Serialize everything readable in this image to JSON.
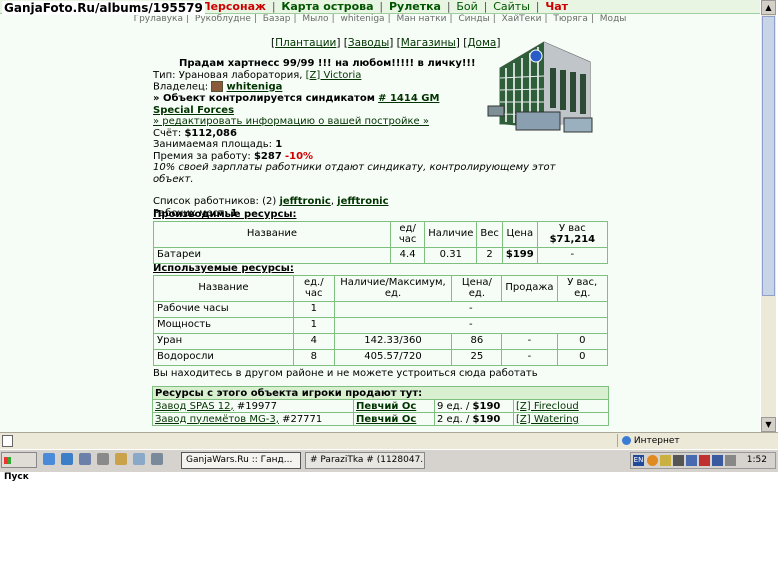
{
  "watermark": "GanjaFoto.Ru/albums/195579",
  "top_nav": {
    "character": "Персонаж",
    "island_map": "Карта острова",
    "roulette": "Рулетка",
    "fight": "Бой",
    "sites": "Сайты",
    "chat": "Чат"
  },
  "sub_nav": [
    "Грулавука",
    "Рукоблудне",
    "Базар",
    "Мыло",
    "whiteniga",
    "Ман натки",
    "Синды",
    "ХайТеки",
    "Тюряга",
    "Моды"
  ],
  "building_menu": [
    "Плантации",
    "Заводы",
    "Магазины",
    "Дома"
  ],
  "building": {
    "ad": "Прадам хартнесс 99/99 !!! на любом!!!!! в личку!!!",
    "type_label": "Тип:",
    "type": "Урановая лаборатория,",
    "island": "[Z] Victoria",
    "owner_label": "Владелец:",
    "owner": "whiteniga",
    "syndicate_prefix": "» Объект контролируется синдикатом",
    "syndicate": "# 1414 GM Special Forces",
    "edit_link": "» редактировать информацию о вашей постройке »",
    "account_label": "Счёт:",
    "account": "$112,086",
    "area_label": "Занимаемая площадь:",
    "area": "1",
    "bonus_label": "Премия за работу:",
    "bonus": "$287",
    "bonus_pct": "-10%",
    "bonus_note": "10% своей зарплаты работники отдают синдикату, контролирующему этот объект.",
    "workers_label": "Список работников: (2)",
    "workers": [
      "jefftronic",
      "jefftronic"
    ],
    "slots_label": "Рабочих мест:",
    "slots": "1"
  },
  "produced": {
    "title": "Производимые ресурсы:",
    "headers": [
      "Название",
      "ед/час",
      "Наличие",
      "Вес",
      "Цена",
      "У вас"
    ],
    "have_total": "$71,214",
    "rows": [
      {
        "name": "Батареи",
        "rate": "4.4",
        "stock": "0.31",
        "weight": "2",
        "price": "$199",
        "have": "-"
      }
    ]
  },
  "used": {
    "title": "Используемые ресурсы:",
    "headers": [
      "Название",
      "ед./час",
      "Наличие/Максимум, ед.",
      "Цена/ед.",
      "Продажа",
      "У вас, ед."
    ],
    "rows": [
      {
        "name": "Рабочие часы",
        "rate": "1",
        "stock": "",
        "price": "-",
        "sale": "",
        "have": ""
      },
      {
        "name": "Мощность",
        "rate": "1",
        "stock": "",
        "price": "-",
        "sale": "",
        "have": ""
      },
      {
        "name": "Уран",
        "rate": "4",
        "stock": "142.33/360",
        "price": "86",
        "sale": "-",
        "have": "0"
      },
      {
        "name": "Водоросли",
        "rate": "8",
        "stock": "405.57/720",
        "price": "25",
        "sale": "-",
        "have": "0"
      }
    ],
    "note": "Вы находитесь в другом районе и не можете устроиться сюда работать"
  },
  "trades": {
    "title": "Ресурсы с этого объекта игроки продают тут:",
    "rows": [
      {
        "place": "Завод SPAS 12,",
        "id": "#19977",
        "seller": "Певчий Ос",
        "qty": "9 ед. /",
        "price": "$190",
        "island": "[Z] Firecloud"
      },
      {
        "place": "Завод пулемётов MG-3,",
        "id": "#27771",
        "seller": "Певчий Ос",
        "qty": "2 ед. /",
        "price": "$190",
        "island": "[Z] Watering"
      }
    ]
  },
  "status_bar": {
    "zone": "Интернет"
  },
  "taskbar": {
    "start": "Пуск",
    "tasks": [
      "GanjaWars.Ru :: Ганд...",
      "# ParaziTka # (1128047..."
    ],
    "lang": "EN",
    "clock": "1:52"
  }
}
